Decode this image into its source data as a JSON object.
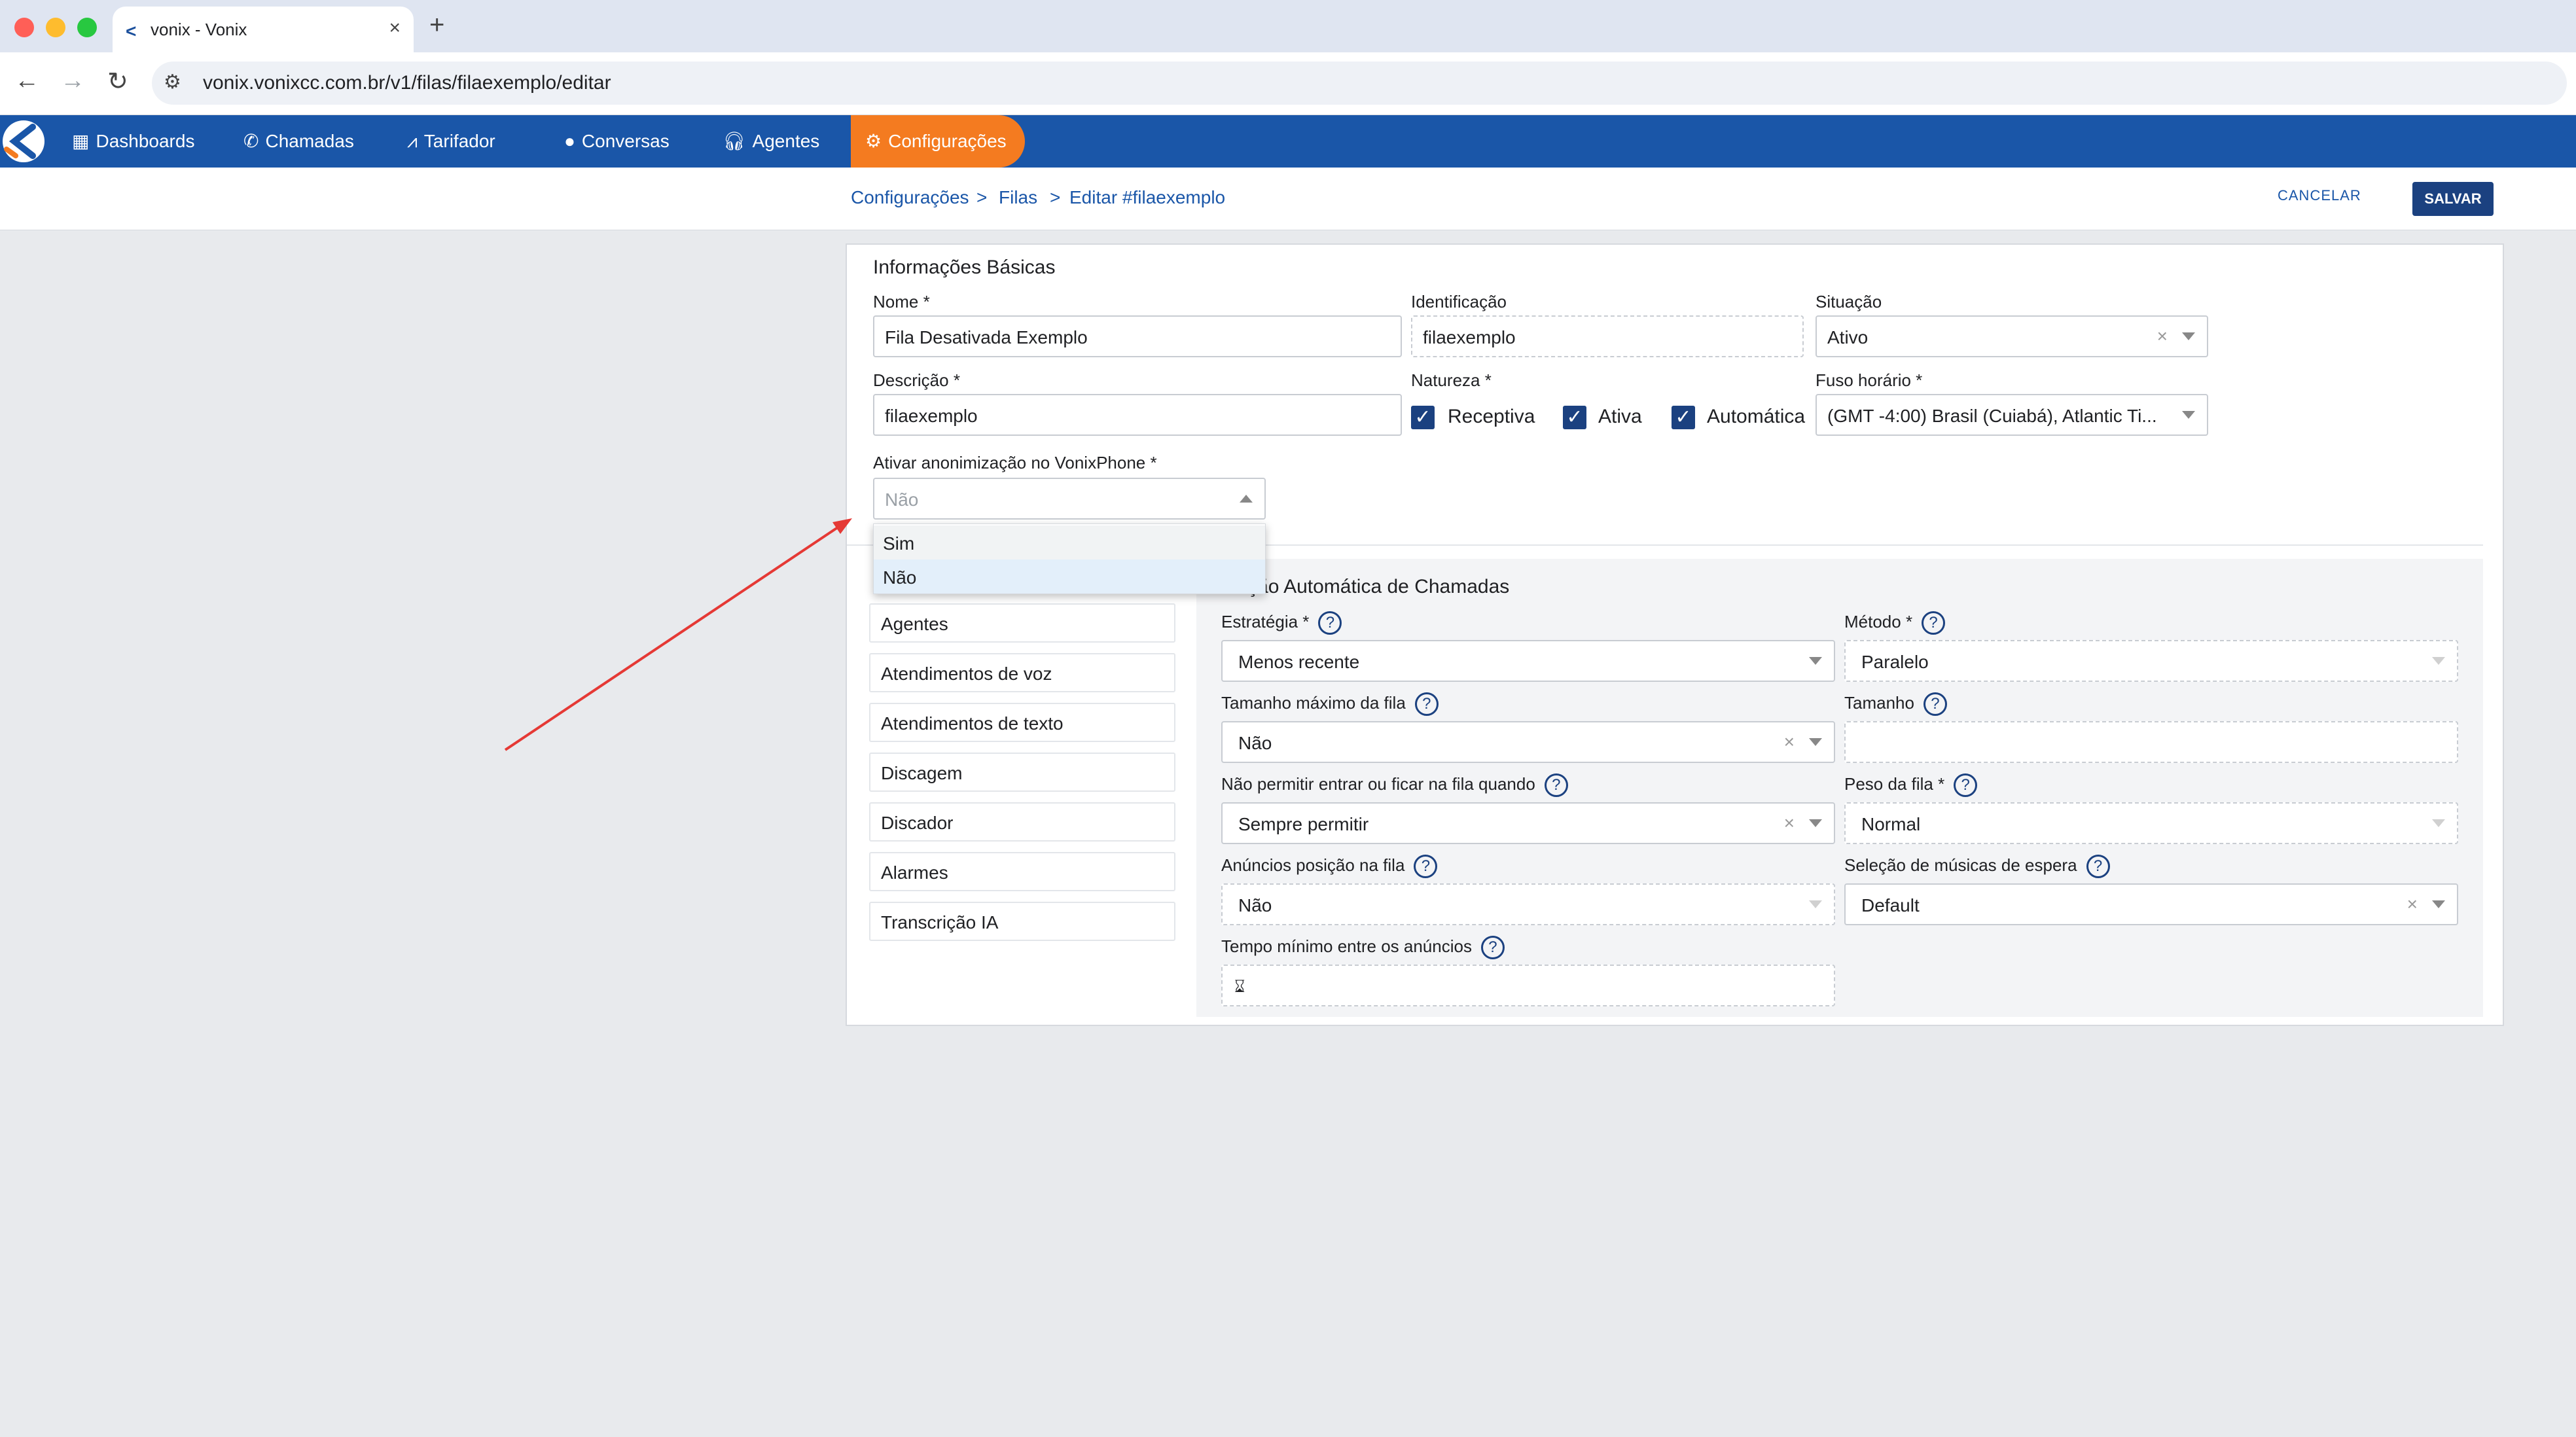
{
  "browser": {
    "tab_title": "vonix - Vonix",
    "url": "vonix.vonixcc.com.br/v1/filas/filaexemplo/editar"
  },
  "nav": {
    "items": [
      {
        "label": "Dashboards",
        "icon": "grid-icon"
      },
      {
        "label": "Chamadas",
        "icon": "phone-icon"
      },
      {
        "label": "Tarifador",
        "icon": "chart-icon"
      },
      {
        "label": "Conversas",
        "icon": "chat-icon"
      },
      {
        "label": "Agentes",
        "icon": "headset-icon"
      },
      {
        "label": "Configurações",
        "icon": "gear-icon",
        "active": true
      }
    ],
    "accent": "#f47b20",
    "bar_color": "#1a56a8"
  },
  "breadcrumb": {
    "items": [
      "Configurações",
      "Filas",
      "Editar #filaexemplo"
    ],
    "separator": ">"
  },
  "actions": {
    "cancel": "CANCELAR",
    "save": "SALVAR"
  },
  "basic_info": {
    "title": "Informações Básicas",
    "nome_label": "Nome *",
    "nome_value": "Fila Desativada Exemplo",
    "identificacao_label": "Identificação",
    "identificacao_value": "filaexemplo",
    "situacao_label": "Situação",
    "situacao_value": "Ativo",
    "descricao_label": "Descrição *",
    "descricao_value": "filaexemplo",
    "natureza_label": "Natureza *",
    "natureza_options": [
      {
        "label": "Receptiva",
        "checked": true
      },
      {
        "label": "Ativa",
        "checked": true
      },
      {
        "label": "Automática",
        "checked": true
      }
    ],
    "fuso_label": "Fuso horário *",
    "fuso_value": "(GMT -4:00) Brasil (Cuiabá), Atlantic Ti...",
    "anon_label": "Ativar anonimização no VonixPhone *",
    "anon_value": "Não",
    "anon_options": [
      "Sim",
      "Não"
    ]
  },
  "left_menu": {
    "items": [
      "Agentes",
      "Atendimentos de voz",
      "Atendimentos de texto",
      "Discagem",
      "Discador",
      "Alarmes",
      "Transcrição IA"
    ]
  },
  "dac": {
    "title": "Distribuição Automática de Chamadas",
    "title_visible": "buição Automática de Chamadas",
    "estrategia_label": "Estratégia *",
    "estrategia_value": "Menos recente",
    "metodo_label": "Método *",
    "metodo_value": "Paralelo",
    "tam_max_label": "Tamanho máximo da fila",
    "tam_max_value": "Não",
    "tamanho_label": "Tamanho",
    "tamanho_value": "",
    "nao_permitir_label": "Não permitir entrar ou ficar na fila quando",
    "nao_permitir_value": "Sempre permitir",
    "peso_label": "Peso da fila *",
    "peso_value": "Normal",
    "anuncios_label": "Anúncios posição na fila",
    "anuncios_value": "Não",
    "musicas_label": "Seleção de músicas de espera",
    "musicas_value": "Default",
    "tempo_label": "Tempo mínimo entre os anúncios",
    "tempo_icon": "hourglass-icon"
  },
  "annotation": {
    "arrow_color": "#e53935"
  }
}
